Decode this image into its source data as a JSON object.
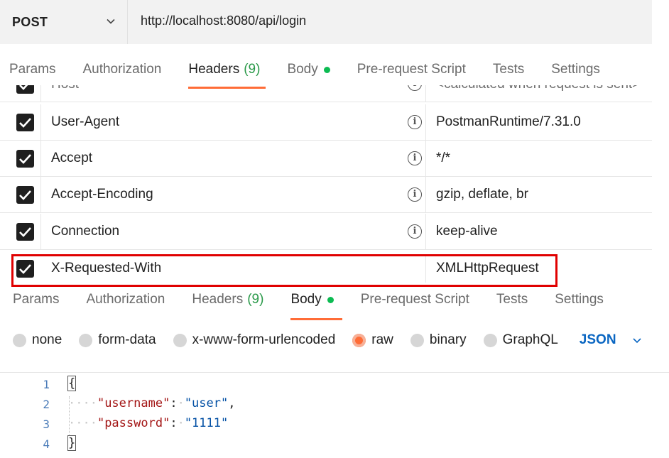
{
  "request": {
    "method": "POST",
    "url": "http://localhost:8080/api/login"
  },
  "tabs_top": [
    {
      "label": "Params"
    },
    {
      "label": "Authorization"
    },
    {
      "label": "Headers",
      "count": "(9)",
      "active": true
    },
    {
      "label": "Body",
      "dot": true
    },
    {
      "label": "Pre-request Script"
    },
    {
      "label": "Tests"
    },
    {
      "label": "Settings"
    }
  ],
  "headers": [
    {
      "key": "Host",
      "value": "<calculated when request is sent>",
      "checked": true
    },
    {
      "key": "User-Agent",
      "value": "PostmanRuntime/7.31.0",
      "checked": true
    },
    {
      "key": "Accept",
      "value": "*/*",
      "checked": true
    },
    {
      "key": "Accept-Encoding",
      "value": "gzip, deflate, br",
      "checked": true
    },
    {
      "key": "Connection",
      "value": "keep-alive",
      "checked": true
    },
    {
      "key": "X-Requested-With",
      "value": "XMLHttpRequest",
      "checked": true
    }
  ],
  "info_glyph": "i",
  "tabs_bottom": [
    {
      "label": "Params"
    },
    {
      "label": "Authorization"
    },
    {
      "label": "Headers",
      "count": "(9)"
    },
    {
      "label": "Body",
      "dot": true,
      "active": true
    },
    {
      "label": "Pre-request Script"
    },
    {
      "label": "Tests"
    },
    {
      "label": "Settings"
    }
  ],
  "body_types": [
    {
      "label": "none"
    },
    {
      "label": "form-data"
    },
    {
      "label": "x-www-form-urlencoded"
    },
    {
      "label": "raw",
      "selected": true
    },
    {
      "label": "binary"
    },
    {
      "label": "GraphQL"
    }
  ],
  "body_format": "JSON",
  "code": {
    "line_numbers": [
      "1",
      "2",
      "3",
      "4"
    ],
    "open_brace": "{",
    "close_brace": "}",
    "indent": "····",
    "fields": [
      {
        "key": "\"username\"",
        "value": "\"user\"",
        "trail": ","
      },
      {
        "key": "\"password\"",
        "value": "\"1111\"",
        "trail": ""
      }
    ]
  },
  "colors": {
    "accent": "#ff6c37",
    "highlight_box": "#e00000",
    "status_dot": "#0cbb52",
    "json_select": "#0a66c2"
  },
  "icons": {
    "method_dropdown": "chevron-down-icon",
    "checkbox": "checkbox-checked-icon",
    "info": "info-icon",
    "format_dropdown": "chevron-down-icon"
  }
}
